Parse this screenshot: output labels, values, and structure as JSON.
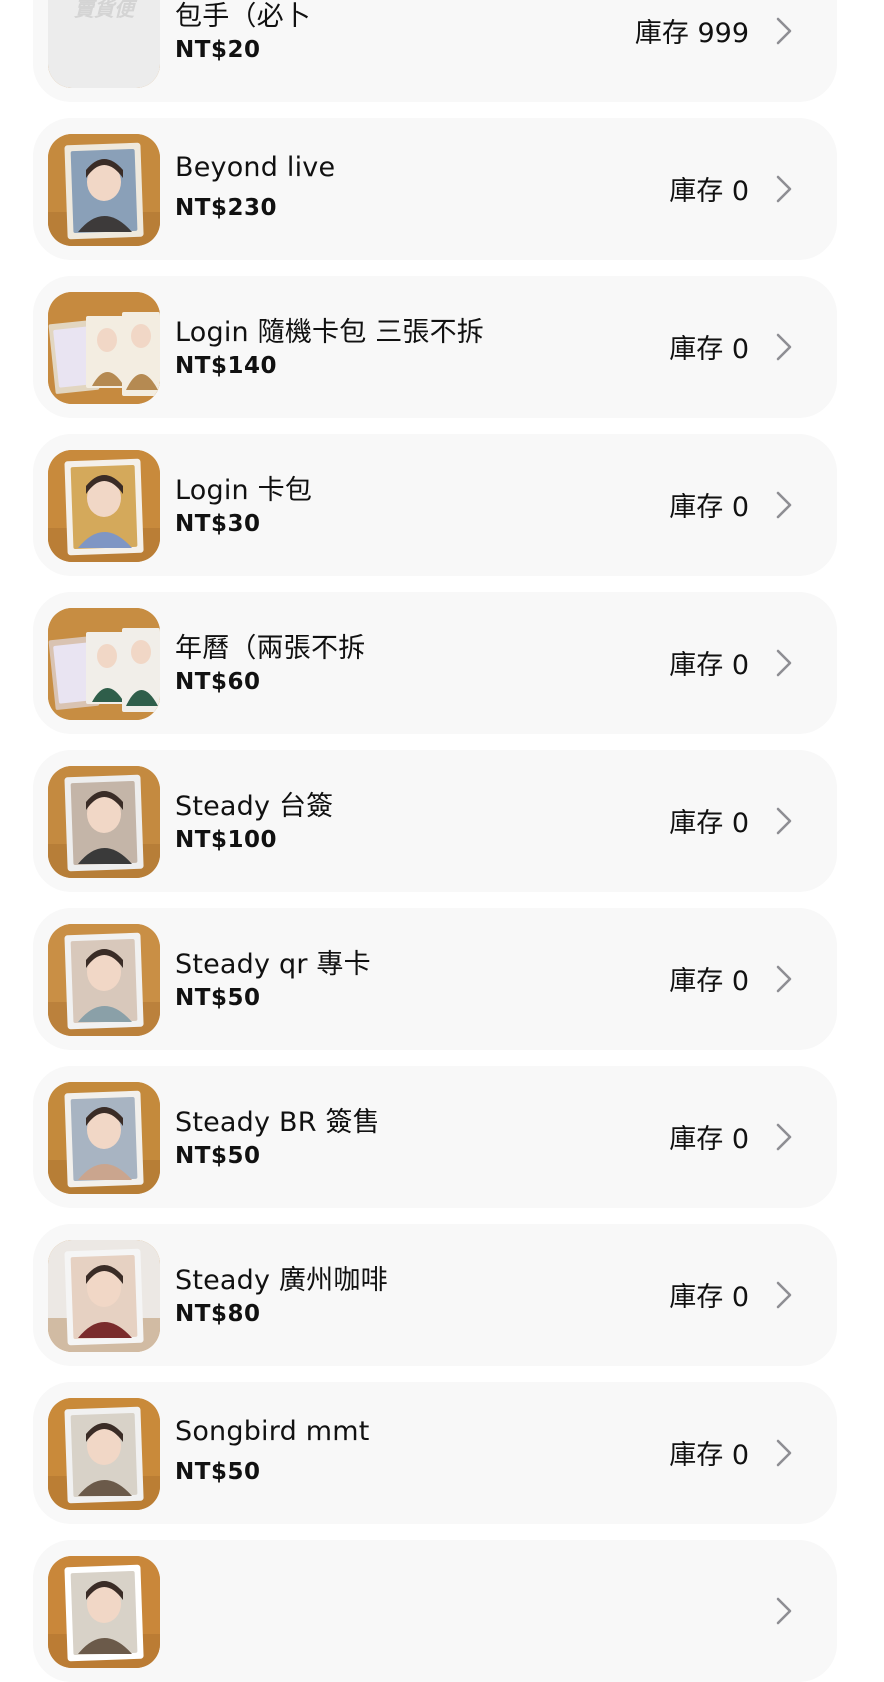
{
  "stock_label": "庫存",
  "thumb_placeholder_text": "賣貨便",
  "colors": {
    "card_bg": "#f8f8f8",
    "text": "#111111",
    "chevron": "#8e8e93",
    "photo_wood": "#c98a3a"
  },
  "products": [
    {
      "name": "包手（必卜",
      "price": "NT$20",
      "stock": "庫存 999",
      "thumb": "placeholder-logo"
    },
    {
      "name": "Beyond live",
      "price": "NT$230",
      "stock": "庫存 0",
      "thumb": "photo-card"
    },
    {
      "name": "Login 隨機卡包 三張不拆",
      "price": "NT$140",
      "stock": "庫存 0",
      "thumb": "photo-cards-group"
    },
    {
      "name": "Login 卡包",
      "price": "NT$30",
      "stock": "庫存 0",
      "thumb": "photo-card"
    },
    {
      "name": "年曆（兩張不拆",
      "price": "NT$60",
      "stock": "庫存 0",
      "thumb": "photo-cards-group"
    },
    {
      "name": "Steady 台簽",
      "price": "NT$100",
      "stock": "庫存 0",
      "thumb": "photo-card"
    },
    {
      "name": "Steady qr 專卡",
      "price": "NT$50",
      "stock": "庫存 0",
      "thumb": "photo-card"
    },
    {
      "name": "Steady BR 簽售",
      "price": "NT$50",
      "stock": "庫存 0",
      "thumb": "photo-card"
    },
    {
      "name": "Steady 廣州咖啡",
      "price": "NT$80",
      "stock": "庫存 0",
      "thumb": "photo-card"
    },
    {
      "name": "Songbird mmt",
      "price": "NT$50",
      "stock": "庫存 0",
      "thumb": "photo-card"
    },
    {
      "name": "",
      "price": "",
      "stock": "",
      "thumb": "photo-card"
    }
  ]
}
